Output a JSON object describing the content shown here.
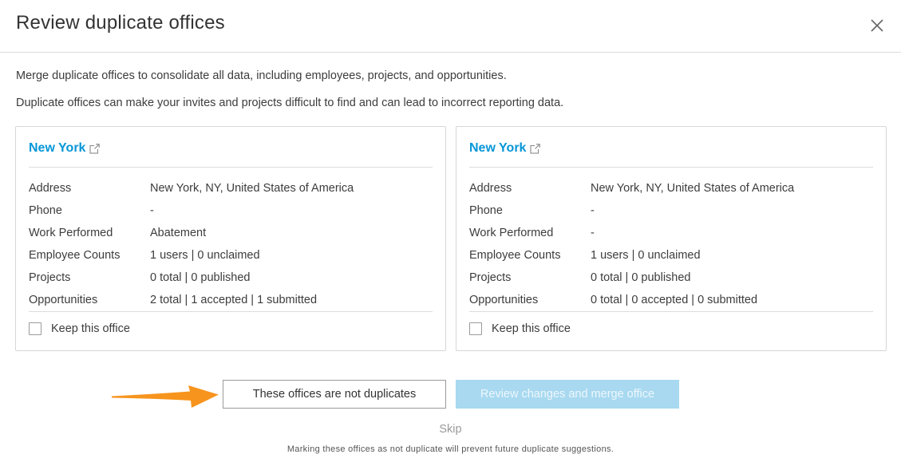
{
  "dialog": {
    "title": "Review duplicate offices",
    "intro_line1": "Merge duplicate offices to consolidate all data, including employees, projects, and opportunities.",
    "intro_line2": "Duplicate offices can make your invites and projects difficult to find and can lead to incorrect reporting data."
  },
  "offices": [
    {
      "name": "New York",
      "rows": [
        {
          "label": "Address",
          "value": "New York, NY, United States of America"
        },
        {
          "label": "Phone",
          "value": "-"
        },
        {
          "label": "Work Performed",
          "value": "Abatement"
        },
        {
          "label": "Employee Counts",
          "value": "1 users | 0 unclaimed"
        },
        {
          "label": "Projects",
          "value": "0 total | 0 published"
        },
        {
          "label": "Opportunities",
          "value": "2 total | 1 accepted | 1 submitted"
        }
      ],
      "keep_label": "Keep this office",
      "keep_checked": false
    },
    {
      "name": "New York",
      "rows": [
        {
          "label": "Address",
          "value": "New York, NY, United States of America"
        },
        {
          "label": "Phone",
          "value": "-"
        },
        {
          "label": "Work Performed",
          "value": "-"
        },
        {
          "label": "Employee Counts",
          "value": "1 users | 0 unclaimed"
        },
        {
          "label": "Projects",
          "value": "0 total | 0 published"
        },
        {
          "label": "Opportunities",
          "value": "0 total | 0 accepted | 0 submitted"
        }
      ],
      "keep_label": "Keep this office",
      "keep_checked": false
    }
  ],
  "actions": {
    "not_duplicates_label": "These offices are not duplicates",
    "merge_label": "Review changes and merge office",
    "skip_label": "Skip",
    "footnote": "Marking these offices as not duplicate will prevent future duplicate suggestions."
  },
  "colors": {
    "link": "#0696d7",
    "primary_disabled": "#a8d9f0",
    "arrow": "#f7941d"
  },
  "icons": {
    "close": "close-icon",
    "external_link": "external-link-icon",
    "annotation_arrow": "arrow-icon"
  }
}
